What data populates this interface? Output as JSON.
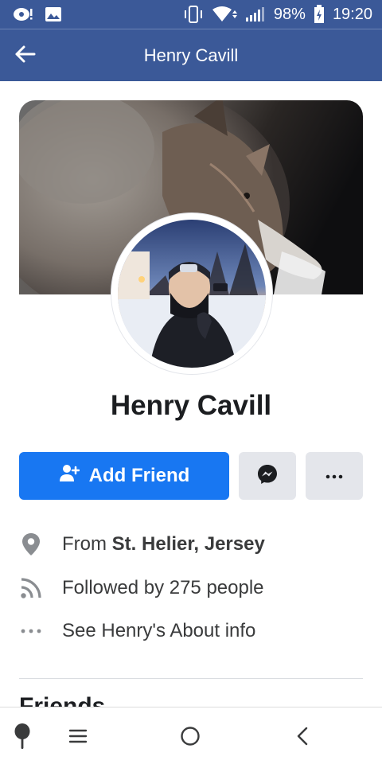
{
  "status_bar": {
    "battery": "98%",
    "time": "19:20",
    "icons": [
      "notification-icon",
      "gallery-icon",
      "vibrate-icon",
      "wifi-icon",
      "signal-icon",
      "battery-charging-icon"
    ]
  },
  "header": {
    "title": "Henry Cavill",
    "back_icon": "arrow-left-icon"
  },
  "profile": {
    "name": "Henry Cavill"
  },
  "actions": {
    "add_friend_label": "Add Friend",
    "add_friend_icon": "add-person-icon",
    "messenger_icon": "messenger-icon",
    "more_icon": "more-dots-icon"
  },
  "info": {
    "from_prefix": "From ",
    "from_place": "St. Helier, Jersey",
    "followers": "Followed by 275 people",
    "about": "See Henry's About info"
  },
  "friends_section": {
    "title": "Friends"
  },
  "colors": {
    "header_bg": "#3b5998",
    "primary_button": "#1877f2",
    "secondary_button": "#e4e6eb",
    "text": "#1c1e21",
    "muted_icon": "#8a8d91"
  }
}
